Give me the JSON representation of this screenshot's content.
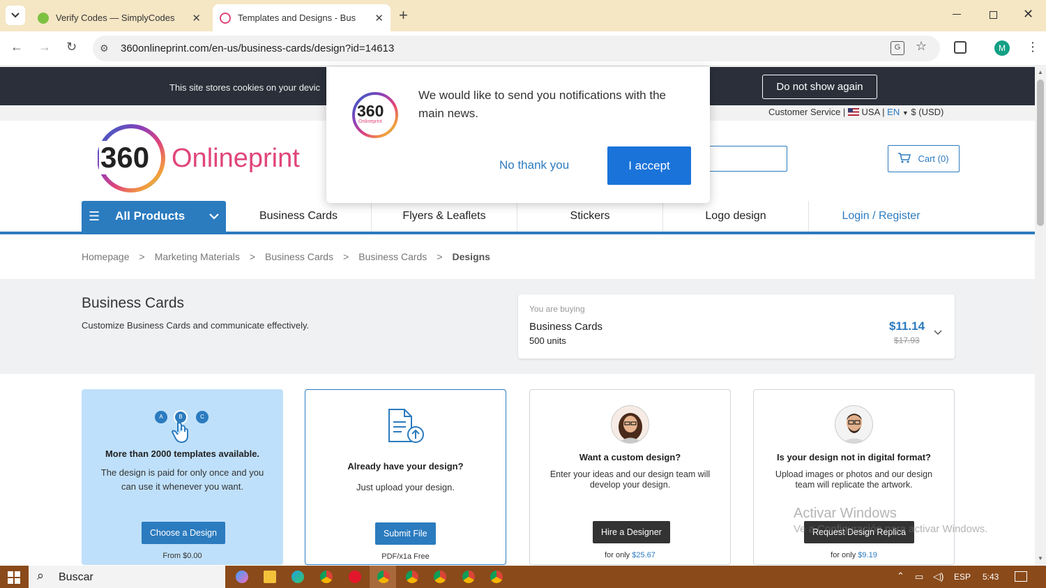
{
  "browser": {
    "tabs": [
      {
        "title": "Verify Codes — SimplyCodes"
      },
      {
        "title": "Templates and Designs - Busine"
      }
    ],
    "url": "360onlineprint.com/en-us/business-cards/design?id=14613",
    "profile_initial": "M"
  },
  "cookie_bar": {
    "text": "This site stores cookies on your devic",
    "dismiss_label": "Do not show again"
  },
  "util_bar": {
    "text": "Customer Service | ",
    "country": "USA",
    "sep": " | ",
    "lang": "EN",
    "currency": " $ (USD)"
  },
  "header": {
    "logo_number": "360",
    "logo_word": "Onlineprint",
    "cart_label": "Cart (0)"
  },
  "nav": {
    "all_products": "All Products",
    "items": [
      "Business Cards",
      "Flyers & Leaflets",
      "Stickers",
      "Logo design"
    ],
    "login": "Login / Register"
  },
  "breadcrumb": [
    "Homepage",
    "Marketing Materials",
    "Business Cards",
    "Business Cards",
    "Designs"
  ],
  "breadcrumb_sep": ">",
  "hero": {
    "title": "Business Cards",
    "subtitle": "Customize Business Cards and communicate effectively."
  },
  "buying": {
    "label": "You are buying",
    "product": "Business Cards",
    "units": "500 units",
    "price": "$11.14",
    "old_price": "$17.93"
  },
  "cards": [
    {
      "title": "More than 2000 templates available.",
      "desc": "The design is paid for only once and you can use it whenever you want.",
      "button": "Choose a Design",
      "foot": "From $0.00",
      "steps": [
        "A",
        "B",
        "C"
      ]
    },
    {
      "title": "Already have your design?",
      "desc": "Just upload your design.",
      "button": "Submit File",
      "foot": "PDF/x1a Free"
    },
    {
      "title": "Want a custom design?",
      "desc": "Enter your ideas and our design team will develop your design.",
      "button": "Hire a Designer",
      "foot_prefix": "for only ",
      "foot_price": "$25.67"
    },
    {
      "title": "Is your design not in digital format?",
      "desc": "Upload images or photos and our design team will replicate the artwork.",
      "button": "Request Design Replica",
      "foot_prefix": "for only ",
      "foot_price": "$9.19"
    }
  ],
  "popup": {
    "message": "We would like to send you notifications with the main news.",
    "decline": "No thank you",
    "accept": "I accept",
    "logo_number": "360",
    "logo_word": "Onlineprint"
  },
  "watermark": {
    "title": "Activar Windows",
    "subtitle": "Ve a Configuración para activar Windows."
  },
  "taskbar": {
    "search": "Buscar",
    "lang": "ESP",
    "time": "5:43"
  },
  "colors": {
    "brand_blue": "#2b7bbf",
    "accept_blue": "#1a73d9",
    "cookie_bg": "#2a2f3a",
    "card1_bg": "#bfe0fa",
    "dark_button": "#333333"
  }
}
